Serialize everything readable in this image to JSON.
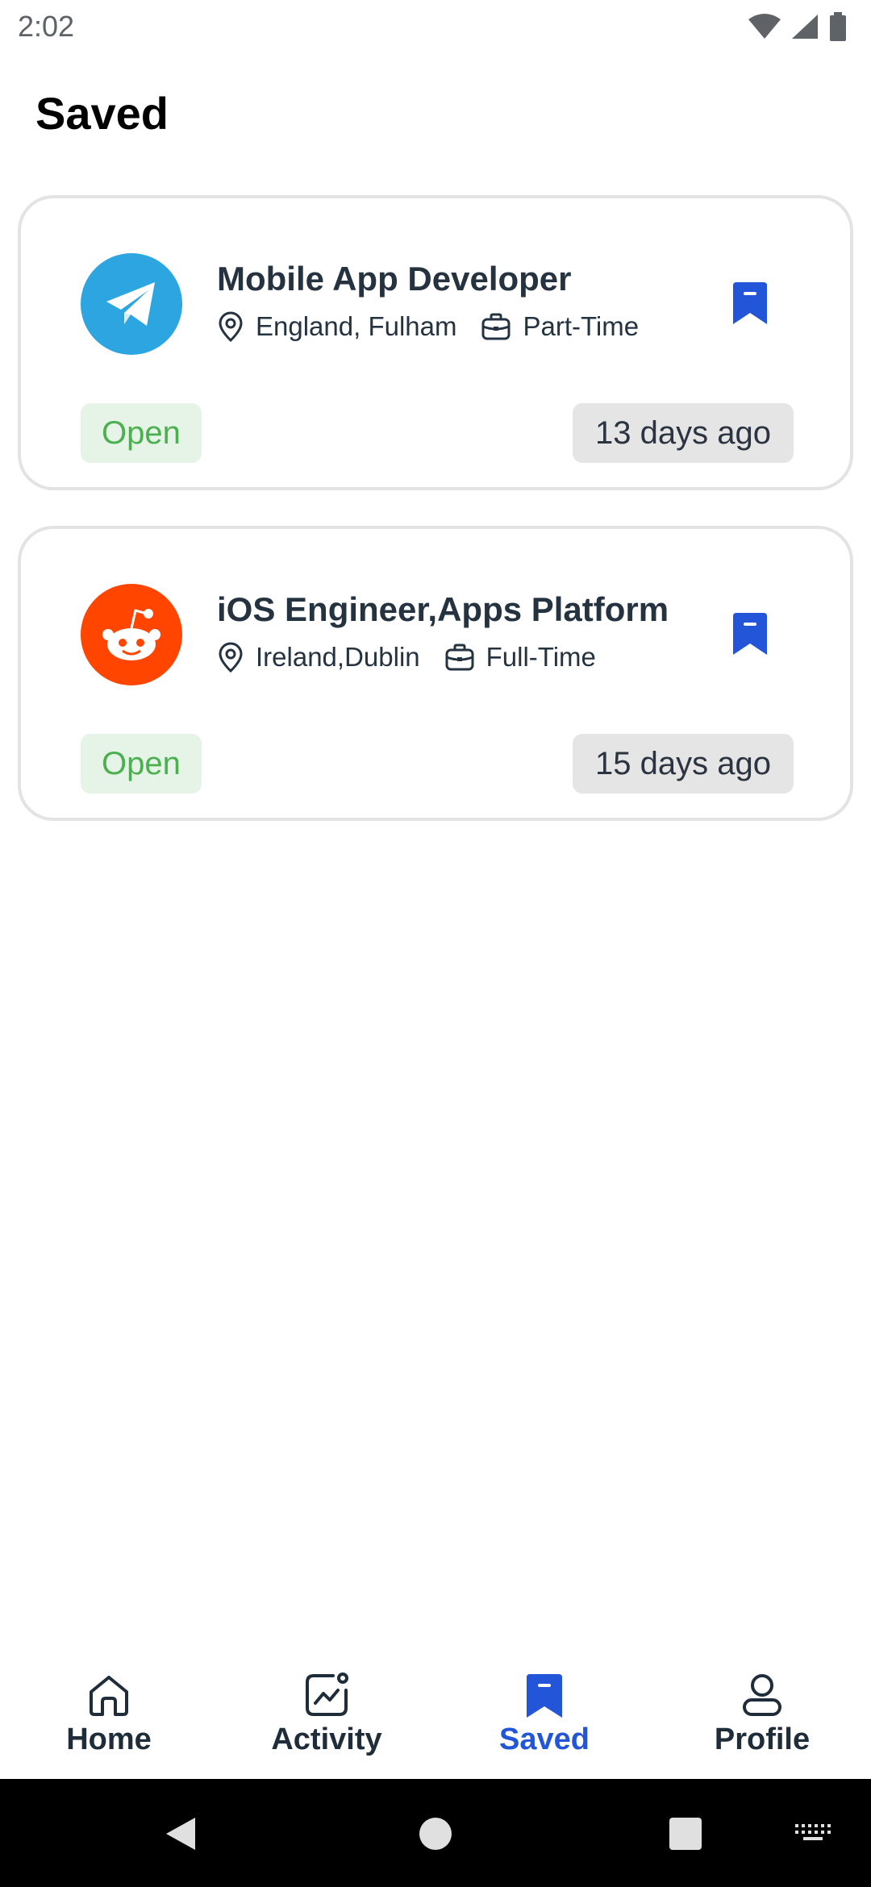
{
  "status_bar": {
    "time": "2:02"
  },
  "page": {
    "title": "Saved"
  },
  "jobs": [
    {
      "title": "Mobile App Developer",
      "location": "England, Fulham",
      "type": "Part-Time",
      "status": "Open",
      "posted": "13 days ago",
      "logo": "telegram-logo",
      "logo_color": "#2ca5e0"
    },
    {
      "title": "iOS Engineer,Apps Platform",
      "location": "Ireland,Dublin",
      "type": "Full-Time",
      "status": "Open",
      "posted": "15 days ago",
      "logo": "reddit-logo",
      "logo_color": "#ff4500"
    }
  ],
  "bottom_nav": {
    "items": [
      {
        "label": "Home",
        "icon": "home-icon"
      },
      {
        "label": "Activity",
        "icon": "activity-icon"
      },
      {
        "label": "Saved",
        "icon": "bookmark-icon",
        "active": true
      },
      {
        "label": "Profile",
        "icon": "profile-icon"
      }
    ]
  },
  "colors": {
    "accent": "#2355d8",
    "open_text": "#4caf50",
    "open_bg": "#e6f4e7",
    "chip_bg": "#e5e5e5"
  }
}
